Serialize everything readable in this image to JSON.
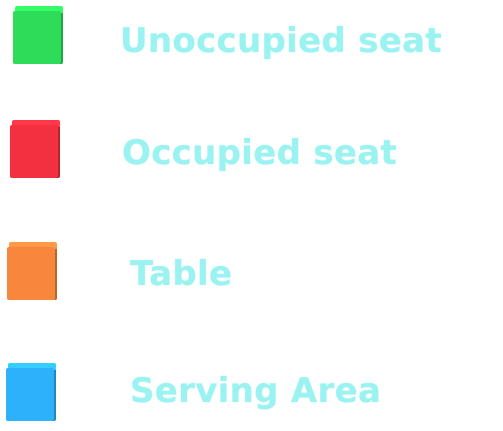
{
  "legend": {
    "label_color": "#9af3f1",
    "items": [
      {
        "label": "Unoccupied seat",
        "color": "#2edc5a",
        "icon": "green-cube-icon"
      },
      {
        "label": "Occupied seat",
        "color": "#f2303f",
        "icon": "red-cube-icon"
      },
      {
        "label": "Table",
        "color": "#f8873d",
        "icon": "orange-cube-icon"
      },
      {
        "label": "Serving Area",
        "color": "#2eb1fb",
        "icon": "blue-cube-icon"
      }
    ]
  }
}
